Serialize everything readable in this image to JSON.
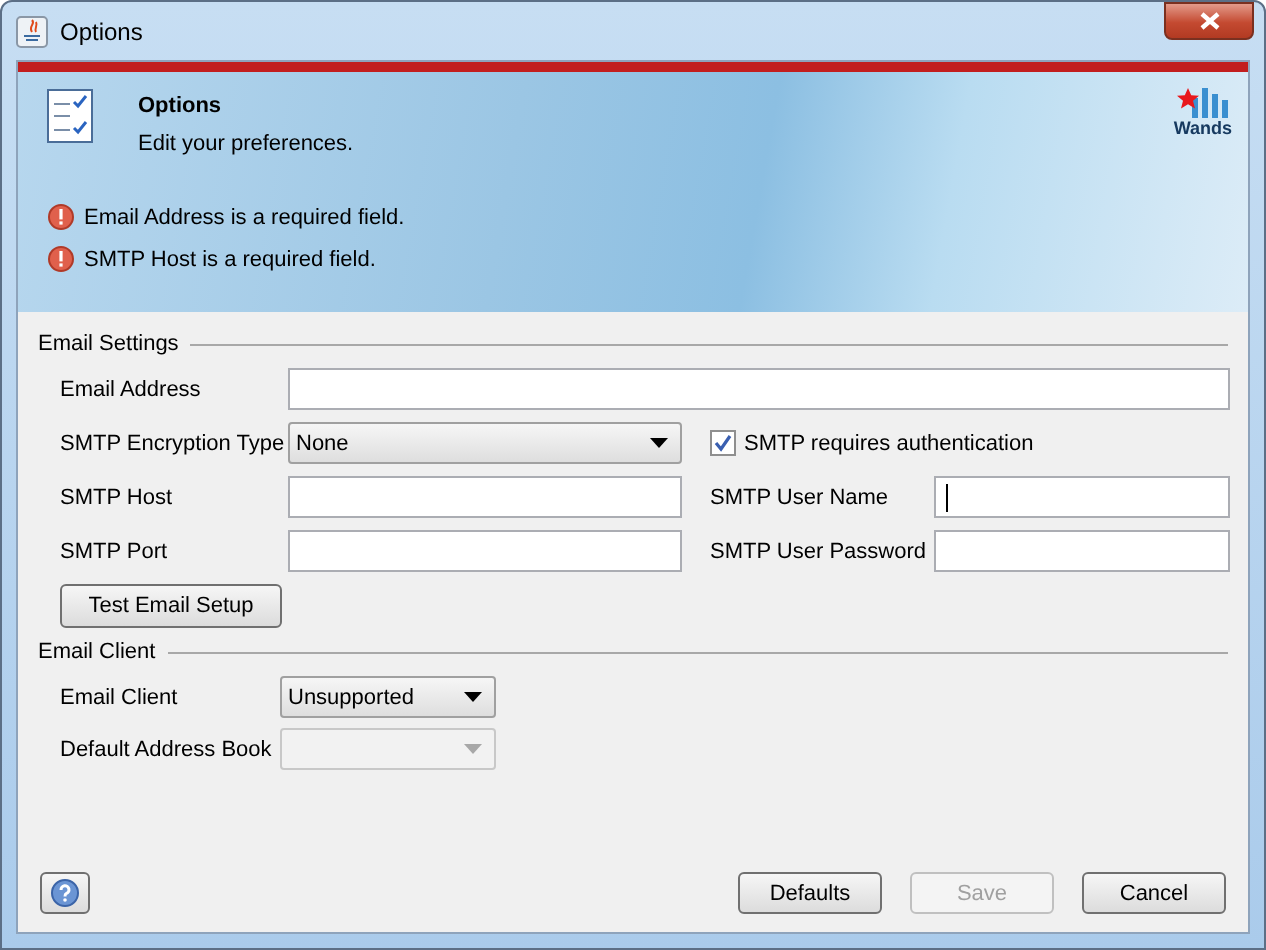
{
  "window": {
    "title": "Options"
  },
  "header": {
    "title": "Options",
    "subtitle": "Edit your preferences.",
    "logo_text": "Wands",
    "errors": [
      "Email Address is a required field.",
      "SMTP Host is a required field."
    ]
  },
  "email_settings": {
    "title": "Email Settings",
    "email_address": {
      "label": "Email Address",
      "focused": false
    },
    "encryption": {
      "label": "SMTP Encryption Type",
      "value": "None"
    },
    "auth": {
      "label": "SMTP requires authentication",
      "checked": true
    },
    "smtp_host": {
      "label": "SMTP Host",
      "focused": false
    },
    "smtp_user": {
      "label": "SMTP User Name",
      "focused": true
    },
    "smtp_port": {
      "label": "SMTP Port",
      "focused": false
    },
    "smtp_password": {
      "label": "SMTP User Password",
      "focused": false
    },
    "test_button": "Test Email Setup"
  },
  "email_client": {
    "title": "Email Client",
    "client": {
      "label": "Email Client",
      "value": "Unsupported",
      "disabled": false
    },
    "address_book": {
      "label": "Default Address Book",
      "disabled": true
    }
  },
  "buttons": [
    {
      "label": "Defaults",
      "disabled": false
    },
    {
      "label": "Save",
      "disabled": true
    },
    {
      "label": "Cancel",
      "disabled": false
    }
  ]
}
